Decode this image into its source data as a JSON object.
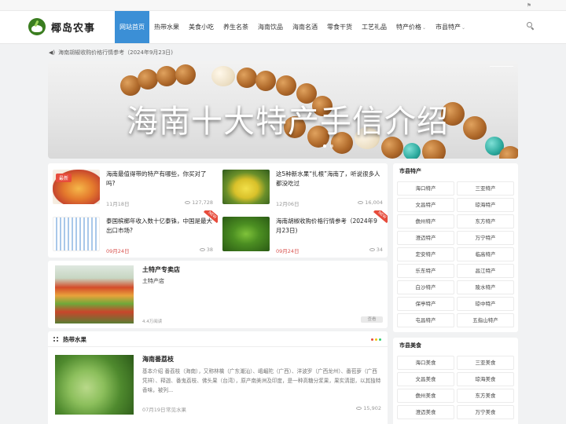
{
  "header": {
    "site_name": "椰岛农事",
    "nav": [
      {
        "label": "网站首页",
        "active": true
      },
      {
        "label": "热带水果"
      },
      {
        "label": "美食小吃"
      },
      {
        "label": "养生名茶"
      },
      {
        "label": "海南饮品"
      },
      {
        "label": "海南名酒"
      },
      {
        "label": "零食干货"
      },
      {
        "label": "工艺礼品"
      },
      {
        "label": "特产价格",
        "caret": "⌄"
      },
      {
        "label": "市县特产",
        "caret": "⌄"
      }
    ],
    "flag_glyph": "⚑"
  },
  "notice": {
    "text": "海南胡椒收购价格行情参考（2024年9月23日)"
  },
  "banner": {
    "title": "海南十大特产手信介绍"
  },
  "featured": [
    {
      "title": "海南最值得带的特产有哪些，你买对了吗?",
      "date": "11月18日",
      "views": "127,728",
      "badge": "最新",
      "red_date": false
    },
    {
      "title": "这5种新水果“扎根”海南了，听说很多人都没吃过",
      "date": "12月06日",
      "views": "16,004",
      "red_date": false
    },
    {
      "title": "泰国槟榔年收入数十亿泰铢，中国是最大出口市场?",
      "date": "09月24日",
      "views": "38",
      "ribbon": "NEW",
      "red_date": true
    },
    {
      "title": "海南胡椒收购价格行情参考（2024年9月23日)",
      "date": "09月24日",
      "views": "34",
      "ribbon": "NEW",
      "red_date": true
    }
  ],
  "shop": {
    "title": "土特产专卖店",
    "subtitle": "土特产店",
    "reads": "4.4万阅读",
    "more": "查看"
  },
  "section": {
    "title": "热带水果",
    "post": {
      "title": "海南番荔枝",
      "excerpt": "基本介绍 番荔枝（海南），又称林檎（广东潮汕）、峨嵋陀（广西）、洋波罗（广西龙州）、番苞萝（广西凭祥）、释迦、番鬼荔枝、佛头果（台湾），原产南美洲及印度，是一种高糖分浆果，果实清甜，以其独特香味，被列...",
      "date": "07月19日",
      "category": "常见水果",
      "views": "15,902"
    }
  },
  "sidebar": {
    "specialty": {
      "title": "市县特产",
      "items": [
        "海口特产",
        "三亚特产",
        "文昌特产",
        "琼海特产",
        "儋州特产",
        "东方特产",
        "澄迈特产",
        "万宁特产",
        "定安特产",
        "临高特产",
        "乐东特产",
        "昌江特产",
        "白沙特产",
        "陵水特产",
        "保亭特产",
        "琼中特产",
        "屯昌特产",
        "五指山特产"
      ]
    },
    "food": {
      "title": "市县美食",
      "items": [
        "海口美食",
        "三亚美食",
        "文昌美食",
        "琼海美食",
        "儋州美食",
        "东方美食",
        "澄迈美食",
        "万宁美食"
      ]
    }
  },
  "colors": {
    "accent": "#3b8fd6",
    "red": "#e74c3c",
    "brand_green": "#3a7d1f"
  },
  "icons": {
    "search": "search-icon",
    "speaker": "speaker-icon",
    "eye": "eye-icon",
    "grid": "grid-icon"
  }
}
